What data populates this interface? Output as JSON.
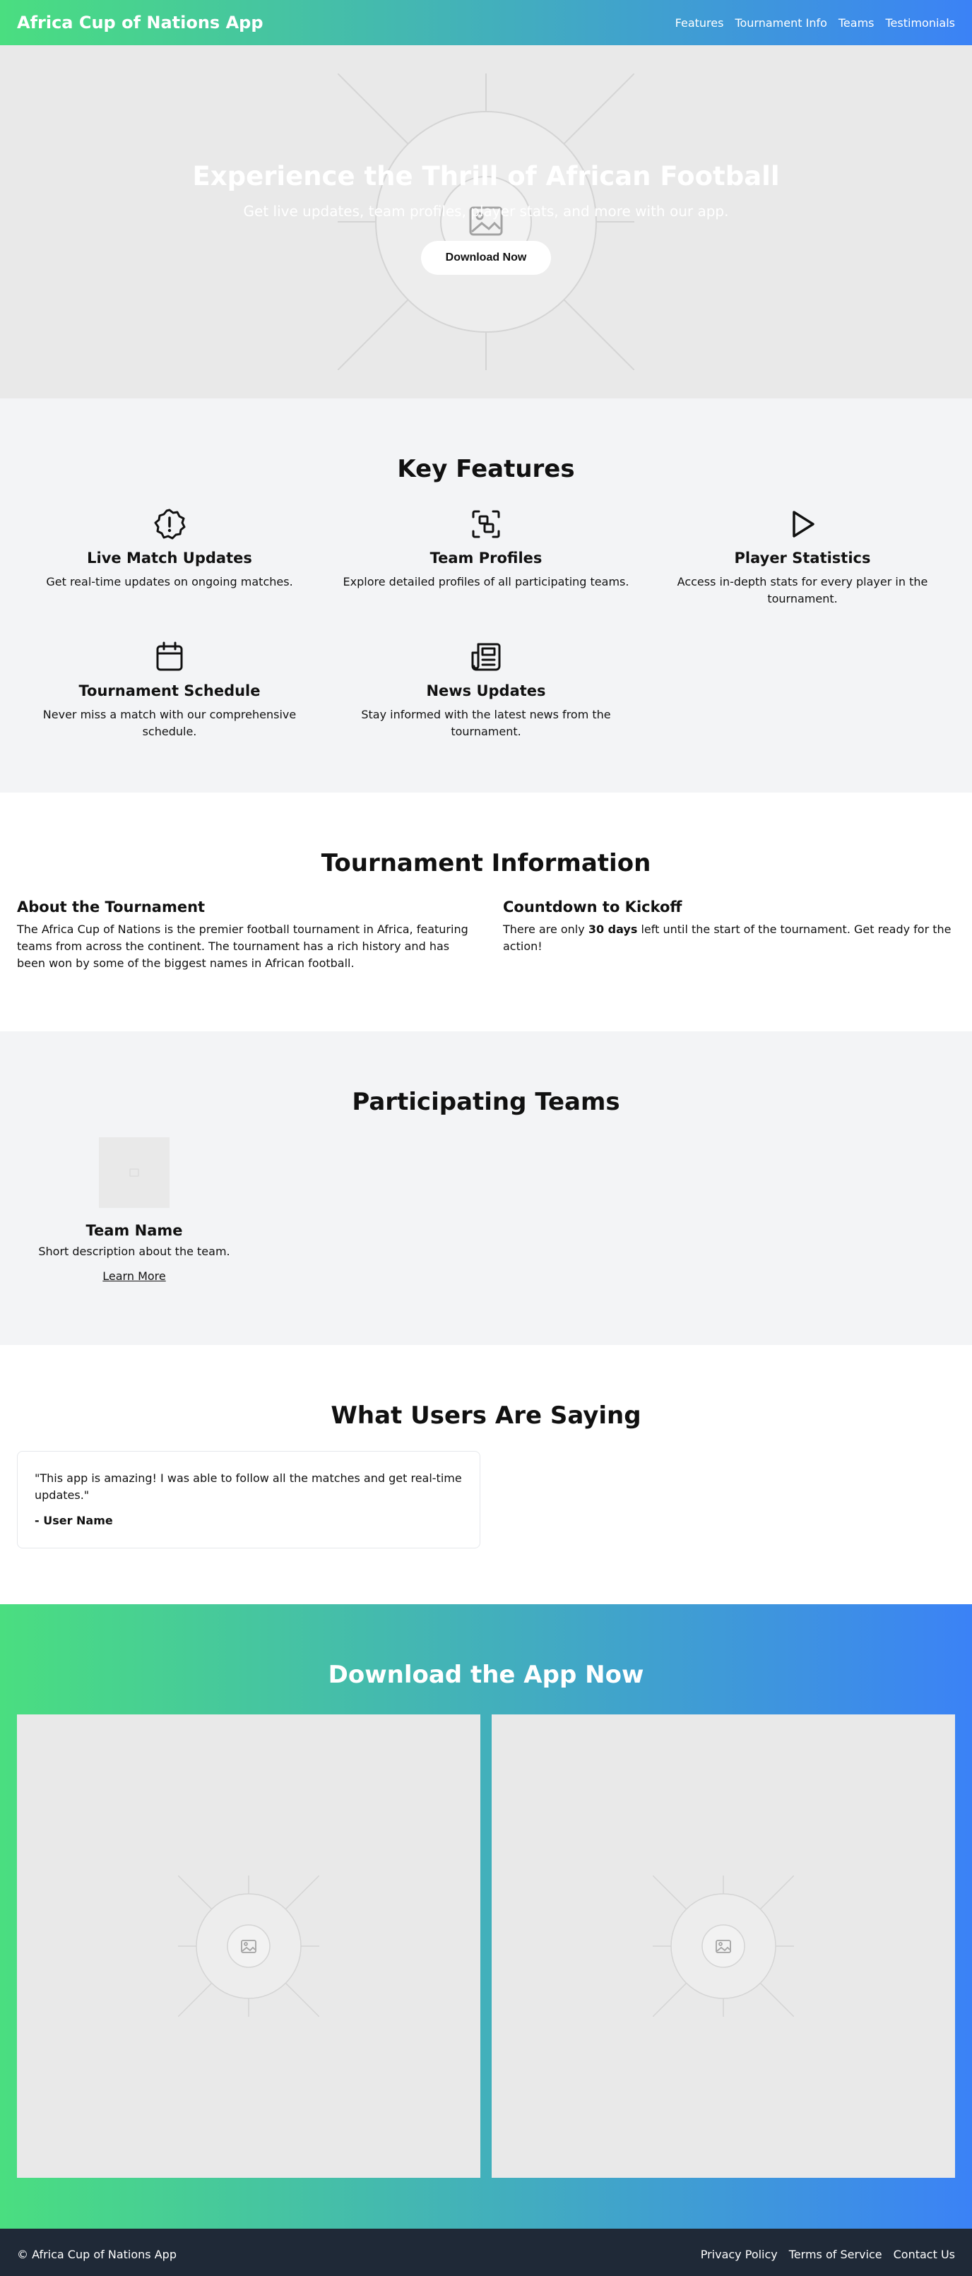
{
  "header": {
    "brand": "Africa Cup of Nations App",
    "nav": [
      "Features",
      "Tournament Info",
      "Teams",
      "Testimonials"
    ]
  },
  "hero": {
    "title": "Experience the Thrill of African Football",
    "subtitle": "Get live updates, team profiles, player stats, and more with our app.",
    "cta": "Download Now",
    "image_icon": "image-placeholder-icon"
  },
  "features": {
    "title": "Key Features",
    "items": [
      {
        "icon": "alert-badge-icon",
        "title": "Live Match Updates",
        "desc": "Get real-time updates on ongoing matches."
      },
      {
        "icon": "shapes-icon",
        "title": "Team Profiles",
        "desc": "Explore detailed profiles of all participating teams."
      },
      {
        "icon": "play-icon",
        "title": "Player Statistics",
        "desc": "Access in-depth stats for every player in the tournament."
      },
      {
        "icon": "calendar-icon",
        "title": "Tournament Schedule",
        "desc": "Never miss a match with our comprehensive schedule."
      },
      {
        "icon": "newspaper-icon",
        "title": "News Updates",
        "desc": "Stay informed with the latest news from the tournament."
      }
    ]
  },
  "info": {
    "title": "Tournament Information",
    "about_title": "About the Tournament",
    "about_text": "The Africa Cup of Nations is the premier football tournament in Africa, featuring teams from across the continent. The tournament has a rich history and has been won by some of the biggest names in African football.",
    "countdown_title": "Countdown to Kickoff",
    "countdown_prefix": "There are only ",
    "countdown_days": "30 days",
    "countdown_suffix": " left until the start of the tournament. Get ready for the action!"
  },
  "teams": {
    "title": "Participating Teams",
    "items": [
      {
        "name": "Team Name",
        "desc": "Short description about the team.",
        "link": "Learn More"
      }
    ]
  },
  "testimonials": {
    "title": "What Users Are Saying",
    "items": [
      {
        "quote": "\"This app is amazing! I was able to follow all the matches and get real-time updates.\"",
        "author": "- User Name"
      }
    ]
  },
  "download": {
    "title": "Download the App Now"
  },
  "footer": {
    "copyright": "© Africa Cup of Nations App",
    "links": [
      "Privacy Policy",
      "Terms of Service",
      "Contact Us"
    ]
  },
  "colors": {
    "gradient_start": "#4ade80",
    "gradient_end": "#3b82f6",
    "section_gray": "#f3f4f6",
    "footer_bg": "#1f2937"
  }
}
